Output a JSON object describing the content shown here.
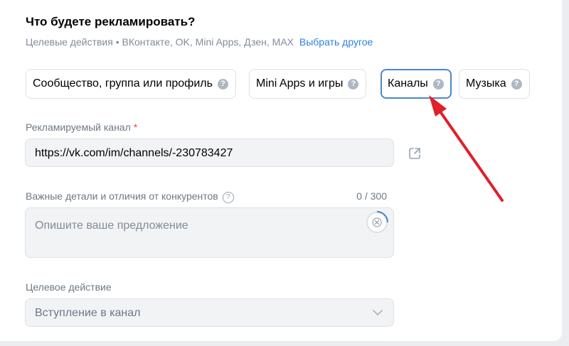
{
  "header": {
    "title": "Что будете рекламировать?",
    "subtitle": "Целевые действия • ВКонтакте, OK, Mini Apps, Дзен, MAX",
    "choose_other_link": "Выбрать другое"
  },
  "categories": [
    {
      "label": "Сообщество, группа или профиль",
      "help": "?"
    },
    {
      "label": "Mini Apps и игры",
      "help": "?"
    },
    {
      "label": "Каналы",
      "help": "?",
      "selected": true
    },
    {
      "label": "Музыка",
      "help": "?"
    }
  ],
  "channel_field": {
    "label": "Рекламируемый канал",
    "required_mark": "*",
    "value": "https://vk.com/im/channels/-230783427"
  },
  "details_field": {
    "label": "Важные детали и отличия от конкурентов",
    "help": "?",
    "counter": "0 / 300",
    "placeholder": "Опишите ваше предложение"
  },
  "target_action": {
    "label": "Целевое действие",
    "value": "Вступление в канал"
  },
  "colors": {
    "link": "#2d81e0",
    "selected_border": "#4a88c7",
    "annotation_arrow": "#e0202a"
  },
  "icons": {
    "external_link": "external-link-icon",
    "clear": "clear-icon",
    "dropdown": "chevron-down-icon"
  }
}
